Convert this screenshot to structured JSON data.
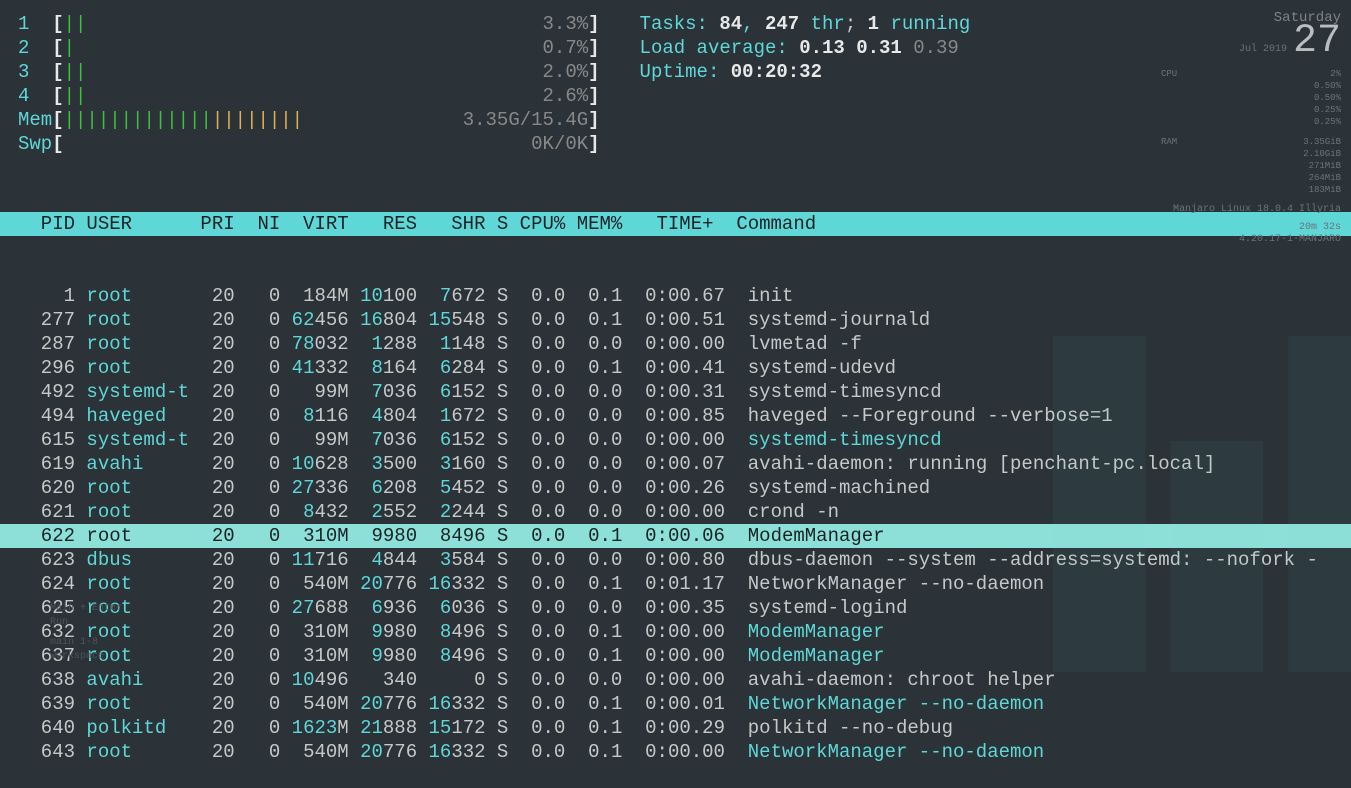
{
  "cpu_meters": [
    {
      "id": "1",
      "bar": "||",
      "pct": "3.3%"
    },
    {
      "id": "2",
      "bar": "|",
      "pct": "0.7%"
    },
    {
      "id": "3",
      "bar": "||",
      "pct": "2.0%"
    },
    {
      "id": "4",
      "bar": "||",
      "pct": "2.6%"
    }
  ],
  "mem": {
    "label": "Mem",
    "bar": "|||||||||||||",
    "bar2": "||||||||",
    "val": "3.35G/15.4G"
  },
  "swp": {
    "label": "Swp",
    "bar": "",
    "val": "0K/0K"
  },
  "tasks": {
    "label": "Tasks: ",
    "count": "84",
    "sep": ", ",
    "thr": "247",
    "thr_lbl": " thr",
    "semi": "; ",
    "running": "1",
    "running_lbl": " running"
  },
  "load": {
    "label": "Load average: ",
    "v1": "0.13",
    "v2": "0.31",
    "v3": "0.39"
  },
  "uptime": {
    "label": "Uptime: ",
    "val": "00:20:32"
  },
  "columns": "  PID USER      PRI  NI  VIRT   RES   SHR S CPU% MEM%   TIME+  Command",
  "widget": {
    "dow": "Saturday",
    "month_year": "Jul 2019",
    "day": "27",
    "cpu_lbl": "CPU",
    "cpu_val": "2%",
    "cpu_rows": [
      "0.50%",
      "0.50%",
      "0.25%",
      "0.25%"
    ],
    "ram_lbl": "RAM",
    "ram_val": "3.35GiB",
    "ram_rows": [
      "2.10GiB",
      "271MiB",
      "264MiB",
      "183MiB"
    ],
    "distro": "Manjaro Linux 18.0.4 Illyria",
    "uptime_small": "20m 32s",
    "kernel": "4.20.17-1-MANJARO"
  },
  "conky": {
    "l1": "Main + Enter",
    "l2": "Run",
    "l3": "main 1-8",
    "l4": "workspace"
  },
  "processes": [
    {
      "pid": "1",
      "user": "root",
      "pri": "20",
      "ni": "0",
      "virt": "184M",
      "virt_hi": "",
      "res": "10100",
      "res_hi": "10",
      "shr": "7672",
      "shr_hi": "7",
      "s": "S",
      "cpu": "0.0",
      "mem": "0.1",
      "time": "0:00.67",
      "cmd": "init",
      "cmd_color": ""
    },
    {
      "pid": "277",
      "user": "root",
      "pri": "20",
      "ni": "0",
      "virt": "62456",
      "virt_hi": "62",
      "res": "16804",
      "res_hi": "16",
      "shr": "15548",
      "shr_hi": "15",
      "s": "S",
      "cpu": "0.0",
      "mem": "0.1",
      "time": "0:00.51",
      "cmd": "systemd-journald",
      "cmd_color": ""
    },
    {
      "pid": "287",
      "user": "root",
      "pri": "20",
      "ni": "0",
      "virt": "78032",
      "virt_hi": "78",
      "res": "1288",
      "res_hi": "1",
      "shr": "1148",
      "shr_hi": "1",
      "s": "S",
      "cpu": "0.0",
      "mem": "0.0",
      "time": "0:00.00",
      "cmd": "lvmetad -f",
      "cmd_color": ""
    },
    {
      "pid": "296",
      "user": "root",
      "pri": "20",
      "ni": "0",
      "virt": "41332",
      "virt_hi": "41",
      "res": "8164",
      "res_hi": "8",
      "shr": "6284",
      "shr_hi": "6",
      "s": "S",
      "cpu": "0.0",
      "mem": "0.1",
      "time": "0:00.41",
      "cmd": "systemd-udevd",
      "cmd_color": ""
    },
    {
      "pid": "492",
      "user": "systemd-t",
      "pri": "20",
      "ni": "0",
      "virt": "99M",
      "virt_hi": "",
      "res": "7036",
      "res_hi": "7",
      "shr": "6152",
      "shr_hi": "6",
      "s": "S",
      "cpu": "0.0",
      "mem": "0.0",
      "time": "0:00.31",
      "cmd": "systemd-timesyncd",
      "cmd_color": ""
    },
    {
      "pid": "494",
      "user": "haveged",
      "pri": "20",
      "ni": "0",
      "virt": "8116",
      "virt_hi": "8",
      "res": "4804",
      "res_hi": "4",
      "shr": "1672",
      "shr_hi": "1",
      "s": "S",
      "cpu": "0.0",
      "mem": "0.0",
      "time": "0:00.85",
      "cmd": "haveged --Foreground --verbose=1",
      "cmd_color": ""
    },
    {
      "pid": "615",
      "user": "systemd-t",
      "pri": "20",
      "ni": "0",
      "virt": "99M",
      "virt_hi": "",
      "res": "7036",
      "res_hi": "7",
      "shr": "6152",
      "shr_hi": "6",
      "s": "S",
      "cpu": "0.0",
      "mem": "0.0",
      "time": "0:00.00",
      "cmd": "systemd-timesyncd",
      "cmd_color": "cyan"
    },
    {
      "pid": "619",
      "user": "avahi",
      "pri": "20",
      "ni": "0",
      "virt": "10628",
      "virt_hi": "10",
      "res": "3500",
      "res_hi": "3",
      "shr": "3160",
      "shr_hi": "3",
      "s": "S",
      "cpu": "0.0",
      "mem": "0.0",
      "time": "0:00.07",
      "cmd": "avahi-daemon: running [penchant-pc.local]",
      "cmd_color": ""
    },
    {
      "pid": "620",
      "user": "root",
      "pri": "20",
      "ni": "0",
      "virt": "27336",
      "virt_hi": "27",
      "res": "6208",
      "res_hi": "6",
      "shr": "5452",
      "shr_hi": "5",
      "s": "S",
      "cpu": "0.0",
      "mem": "0.0",
      "time": "0:00.26",
      "cmd": "systemd-machined",
      "cmd_color": ""
    },
    {
      "pid": "621",
      "user": "root",
      "pri": "20",
      "ni": "0",
      "virt": "8432",
      "virt_hi": "8",
      "res": "2552",
      "res_hi": "2",
      "shr": "2244",
      "shr_hi": "2",
      "s": "S",
      "cpu": "0.0",
      "mem": "0.0",
      "time": "0:00.00",
      "cmd": "crond -n",
      "cmd_color": ""
    },
    {
      "pid": "622",
      "user": "root",
      "pri": "20",
      "ni": "0",
      "virt": "310M",
      "virt_hi": "",
      "res": "9980",
      "res_hi": "9",
      "shr": "8496",
      "shr_hi": "8",
      "s": "S",
      "cpu": "0.0",
      "mem": "0.1",
      "time": "0:00.06",
      "cmd": "ModemManager",
      "cmd_color": "",
      "selected": true
    },
    {
      "pid": "623",
      "user": "dbus",
      "pri": "20",
      "ni": "0",
      "virt": "11716",
      "virt_hi": "11",
      "res": "4844",
      "res_hi": "4",
      "shr": "3584",
      "shr_hi": "3",
      "s": "S",
      "cpu": "0.0",
      "mem": "0.0",
      "time": "0:00.80",
      "cmd": "dbus-daemon --system --address=systemd: --nofork -",
      "cmd_color": ""
    },
    {
      "pid": "624",
      "user": "root",
      "pri": "20",
      "ni": "0",
      "virt": "540M",
      "virt_hi": "",
      "res": "20776",
      "res_hi": "20",
      "shr": "16332",
      "shr_hi": "16",
      "s": "S",
      "cpu": "0.0",
      "mem": "0.1",
      "time": "0:01.17",
      "cmd": "NetworkManager --no-daemon",
      "cmd_color": ""
    },
    {
      "pid": "625",
      "user": "root",
      "pri": "20",
      "ni": "0",
      "virt": "27688",
      "virt_hi": "27",
      "res": "6936",
      "res_hi": "6",
      "shr": "6036",
      "shr_hi": "6",
      "s": "S",
      "cpu": "0.0",
      "mem": "0.0",
      "time": "0:00.35",
      "cmd": "systemd-logind",
      "cmd_color": ""
    },
    {
      "pid": "632",
      "user": "root",
      "pri": "20",
      "ni": "0",
      "virt": "310M",
      "virt_hi": "",
      "res": "9980",
      "res_hi": "9",
      "shr": "8496",
      "shr_hi": "8",
      "s": "S",
      "cpu": "0.0",
      "mem": "0.1",
      "time": "0:00.00",
      "cmd": "ModemManager",
      "cmd_color": "cyan"
    },
    {
      "pid": "637",
      "user": "root",
      "pri": "20",
      "ni": "0",
      "virt": "310M",
      "virt_hi": "",
      "res": "9980",
      "res_hi": "9",
      "shr": "8496",
      "shr_hi": "8",
      "s": "S",
      "cpu": "0.0",
      "mem": "0.1",
      "time": "0:00.00",
      "cmd": "ModemManager",
      "cmd_color": "cyan"
    },
    {
      "pid": "638",
      "user": "avahi",
      "pri": "20",
      "ni": "0",
      "virt": "10496",
      "virt_hi": "10",
      "res": "340",
      "res_hi": "",
      "shr": "0",
      "shr_hi": "",
      "s": "S",
      "cpu": "0.0",
      "mem": "0.0",
      "time": "0:00.00",
      "cmd": "avahi-daemon: chroot helper",
      "cmd_color": ""
    },
    {
      "pid": "639",
      "user": "root",
      "pri": "20",
      "ni": "0",
      "virt": "540M",
      "virt_hi": "",
      "res": "20776",
      "res_hi": "20",
      "shr": "16332",
      "shr_hi": "16",
      "s": "S",
      "cpu": "0.0",
      "mem": "0.1",
      "time": "0:00.01",
      "cmd": "NetworkManager --no-daemon",
      "cmd_color": "cyan"
    },
    {
      "pid": "640",
      "user": "polkitd",
      "pri": "20",
      "ni": "0",
      "virt": "1623M",
      "virt_hi": "1623",
      "res": "21888",
      "res_hi": "21",
      "shr": "15172",
      "shr_hi": "15",
      "s": "S",
      "cpu": "0.0",
      "mem": "0.1",
      "time": "0:00.29",
      "cmd": "polkitd --no-debug",
      "cmd_color": ""
    },
    {
      "pid": "643",
      "user": "root",
      "pri": "20",
      "ni": "0",
      "virt": "540M",
      "virt_hi": "",
      "res": "20776",
      "res_hi": "20",
      "shr": "16332",
      "shr_hi": "16",
      "s": "S",
      "cpu": "0.0",
      "mem": "0.1",
      "time": "0:00.00",
      "cmd": "NetworkManager --no-daemon",
      "cmd_color": "cyan"
    }
  ]
}
